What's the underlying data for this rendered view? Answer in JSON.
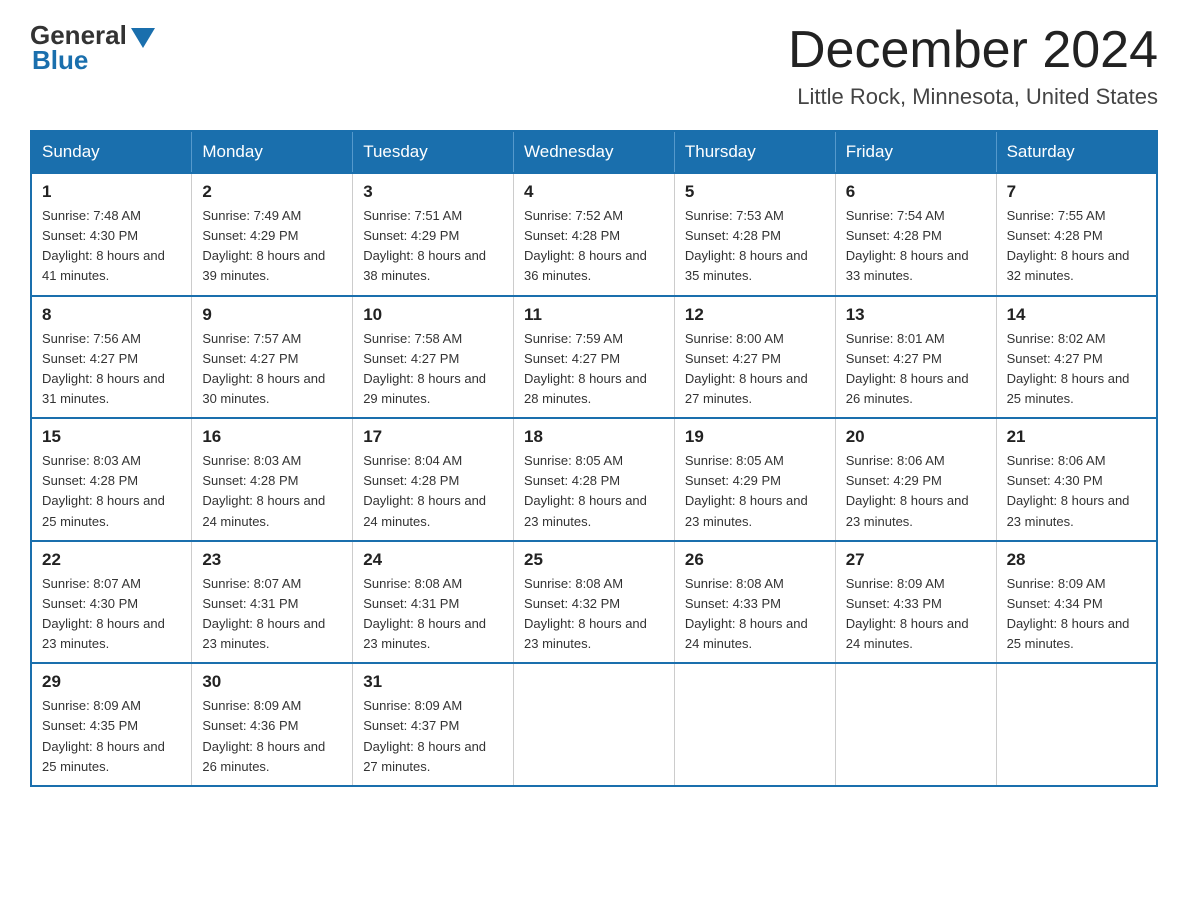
{
  "logo": {
    "text_general": "General",
    "text_blue": "Blue"
  },
  "title": "December 2024",
  "location": "Little Rock, Minnesota, United States",
  "days_of_week": [
    "Sunday",
    "Monday",
    "Tuesday",
    "Wednesday",
    "Thursday",
    "Friday",
    "Saturday"
  ],
  "weeks": [
    [
      {
        "day": "1",
        "sunrise": "Sunrise: 7:48 AM",
        "sunset": "Sunset: 4:30 PM",
        "daylight": "Daylight: 8 hours and 41 minutes."
      },
      {
        "day": "2",
        "sunrise": "Sunrise: 7:49 AM",
        "sunset": "Sunset: 4:29 PM",
        "daylight": "Daylight: 8 hours and 39 minutes."
      },
      {
        "day": "3",
        "sunrise": "Sunrise: 7:51 AM",
        "sunset": "Sunset: 4:29 PM",
        "daylight": "Daylight: 8 hours and 38 minutes."
      },
      {
        "day": "4",
        "sunrise": "Sunrise: 7:52 AM",
        "sunset": "Sunset: 4:28 PM",
        "daylight": "Daylight: 8 hours and 36 minutes."
      },
      {
        "day": "5",
        "sunrise": "Sunrise: 7:53 AM",
        "sunset": "Sunset: 4:28 PM",
        "daylight": "Daylight: 8 hours and 35 minutes."
      },
      {
        "day": "6",
        "sunrise": "Sunrise: 7:54 AM",
        "sunset": "Sunset: 4:28 PM",
        "daylight": "Daylight: 8 hours and 33 minutes."
      },
      {
        "day": "7",
        "sunrise": "Sunrise: 7:55 AM",
        "sunset": "Sunset: 4:28 PM",
        "daylight": "Daylight: 8 hours and 32 minutes."
      }
    ],
    [
      {
        "day": "8",
        "sunrise": "Sunrise: 7:56 AM",
        "sunset": "Sunset: 4:27 PM",
        "daylight": "Daylight: 8 hours and 31 minutes."
      },
      {
        "day": "9",
        "sunrise": "Sunrise: 7:57 AM",
        "sunset": "Sunset: 4:27 PM",
        "daylight": "Daylight: 8 hours and 30 minutes."
      },
      {
        "day": "10",
        "sunrise": "Sunrise: 7:58 AM",
        "sunset": "Sunset: 4:27 PM",
        "daylight": "Daylight: 8 hours and 29 minutes."
      },
      {
        "day": "11",
        "sunrise": "Sunrise: 7:59 AM",
        "sunset": "Sunset: 4:27 PM",
        "daylight": "Daylight: 8 hours and 28 minutes."
      },
      {
        "day": "12",
        "sunrise": "Sunrise: 8:00 AM",
        "sunset": "Sunset: 4:27 PM",
        "daylight": "Daylight: 8 hours and 27 minutes."
      },
      {
        "day": "13",
        "sunrise": "Sunrise: 8:01 AM",
        "sunset": "Sunset: 4:27 PM",
        "daylight": "Daylight: 8 hours and 26 minutes."
      },
      {
        "day": "14",
        "sunrise": "Sunrise: 8:02 AM",
        "sunset": "Sunset: 4:27 PM",
        "daylight": "Daylight: 8 hours and 25 minutes."
      }
    ],
    [
      {
        "day": "15",
        "sunrise": "Sunrise: 8:03 AM",
        "sunset": "Sunset: 4:28 PM",
        "daylight": "Daylight: 8 hours and 25 minutes."
      },
      {
        "day": "16",
        "sunrise": "Sunrise: 8:03 AM",
        "sunset": "Sunset: 4:28 PM",
        "daylight": "Daylight: 8 hours and 24 minutes."
      },
      {
        "day": "17",
        "sunrise": "Sunrise: 8:04 AM",
        "sunset": "Sunset: 4:28 PM",
        "daylight": "Daylight: 8 hours and 24 minutes."
      },
      {
        "day": "18",
        "sunrise": "Sunrise: 8:05 AM",
        "sunset": "Sunset: 4:28 PM",
        "daylight": "Daylight: 8 hours and 23 minutes."
      },
      {
        "day": "19",
        "sunrise": "Sunrise: 8:05 AM",
        "sunset": "Sunset: 4:29 PM",
        "daylight": "Daylight: 8 hours and 23 minutes."
      },
      {
        "day": "20",
        "sunrise": "Sunrise: 8:06 AM",
        "sunset": "Sunset: 4:29 PM",
        "daylight": "Daylight: 8 hours and 23 minutes."
      },
      {
        "day": "21",
        "sunrise": "Sunrise: 8:06 AM",
        "sunset": "Sunset: 4:30 PM",
        "daylight": "Daylight: 8 hours and 23 minutes."
      }
    ],
    [
      {
        "day": "22",
        "sunrise": "Sunrise: 8:07 AM",
        "sunset": "Sunset: 4:30 PM",
        "daylight": "Daylight: 8 hours and 23 minutes."
      },
      {
        "day": "23",
        "sunrise": "Sunrise: 8:07 AM",
        "sunset": "Sunset: 4:31 PM",
        "daylight": "Daylight: 8 hours and 23 minutes."
      },
      {
        "day": "24",
        "sunrise": "Sunrise: 8:08 AM",
        "sunset": "Sunset: 4:31 PM",
        "daylight": "Daylight: 8 hours and 23 minutes."
      },
      {
        "day": "25",
        "sunrise": "Sunrise: 8:08 AM",
        "sunset": "Sunset: 4:32 PM",
        "daylight": "Daylight: 8 hours and 23 minutes."
      },
      {
        "day": "26",
        "sunrise": "Sunrise: 8:08 AM",
        "sunset": "Sunset: 4:33 PM",
        "daylight": "Daylight: 8 hours and 24 minutes."
      },
      {
        "day": "27",
        "sunrise": "Sunrise: 8:09 AM",
        "sunset": "Sunset: 4:33 PM",
        "daylight": "Daylight: 8 hours and 24 minutes."
      },
      {
        "day": "28",
        "sunrise": "Sunrise: 8:09 AM",
        "sunset": "Sunset: 4:34 PM",
        "daylight": "Daylight: 8 hours and 25 minutes."
      }
    ],
    [
      {
        "day": "29",
        "sunrise": "Sunrise: 8:09 AM",
        "sunset": "Sunset: 4:35 PM",
        "daylight": "Daylight: 8 hours and 25 minutes."
      },
      {
        "day": "30",
        "sunrise": "Sunrise: 8:09 AM",
        "sunset": "Sunset: 4:36 PM",
        "daylight": "Daylight: 8 hours and 26 minutes."
      },
      {
        "day": "31",
        "sunrise": "Sunrise: 8:09 AM",
        "sunset": "Sunset: 4:37 PM",
        "daylight": "Daylight: 8 hours and 27 minutes."
      },
      {
        "day": "",
        "sunrise": "",
        "sunset": "",
        "daylight": ""
      },
      {
        "day": "",
        "sunrise": "",
        "sunset": "",
        "daylight": ""
      },
      {
        "day": "",
        "sunrise": "",
        "sunset": "",
        "daylight": ""
      },
      {
        "day": "",
        "sunrise": "",
        "sunset": "",
        "daylight": ""
      }
    ]
  ]
}
